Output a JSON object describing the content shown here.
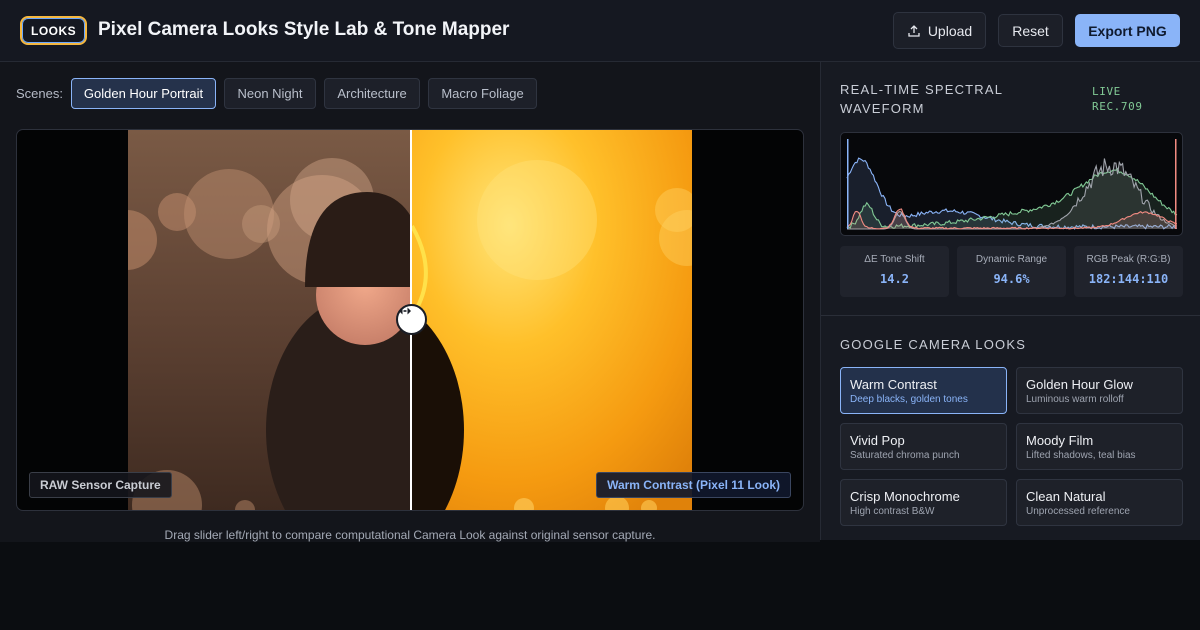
{
  "header": {
    "logo": "LOOKS",
    "title": "Pixel Camera Looks Style Lab & Tone Mapper",
    "upload_label": "Upload",
    "reset_label": "Reset",
    "export_label": "Export PNG"
  },
  "scenes": {
    "label": "Scenes:",
    "items": [
      "Golden Hour Portrait",
      "Neon Night",
      "Architecture",
      "Macro Foliage"
    ],
    "active": "Golden Hour Portrait"
  },
  "viewer": {
    "left_tag": "RAW Sensor Capture",
    "right_tag": "Warm Contrast (Pixel 11 Look)",
    "hint": "Drag slider left/right to compare computational Camera Look against original sensor capture."
  },
  "waveform": {
    "title": "Real-time Spectral Waveform",
    "badge_line1": "LIVE",
    "badge_line2": "REC.709"
  },
  "stats": [
    {
      "label": "ΔE Tone Shift",
      "value": "14.2"
    },
    {
      "label": "Dynamic Range",
      "value": "94.6%"
    },
    {
      "label": "RGB Peak (R:G:B)",
      "value": "182:144:110"
    }
  ],
  "looks": {
    "title": "Google Camera Looks",
    "items": [
      {
        "name": "Warm Contrast",
        "desc": "Deep blacks, golden tones"
      },
      {
        "name": "Golden Hour Glow",
        "desc": "Luminous warm rolloff"
      },
      {
        "name": "Vivid Pop",
        "desc": "Saturated chroma punch"
      },
      {
        "name": "Moody Film",
        "desc": "Lifted shadows, teal bias"
      },
      {
        "name": "Crisp Monochrome",
        "desc": "High contrast B&W"
      },
      {
        "name": "Clean Natural",
        "desc": "Unprocessed reference"
      }
    ],
    "active": "Warm Contrast"
  },
  "colors": {
    "accent": "#8ab4f8",
    "live": "#81c995",
    "wave_red": "#f28b82",
    "wave_green": "#81c995",
    "wave_blue": "#8ab4f8"
  }
}
